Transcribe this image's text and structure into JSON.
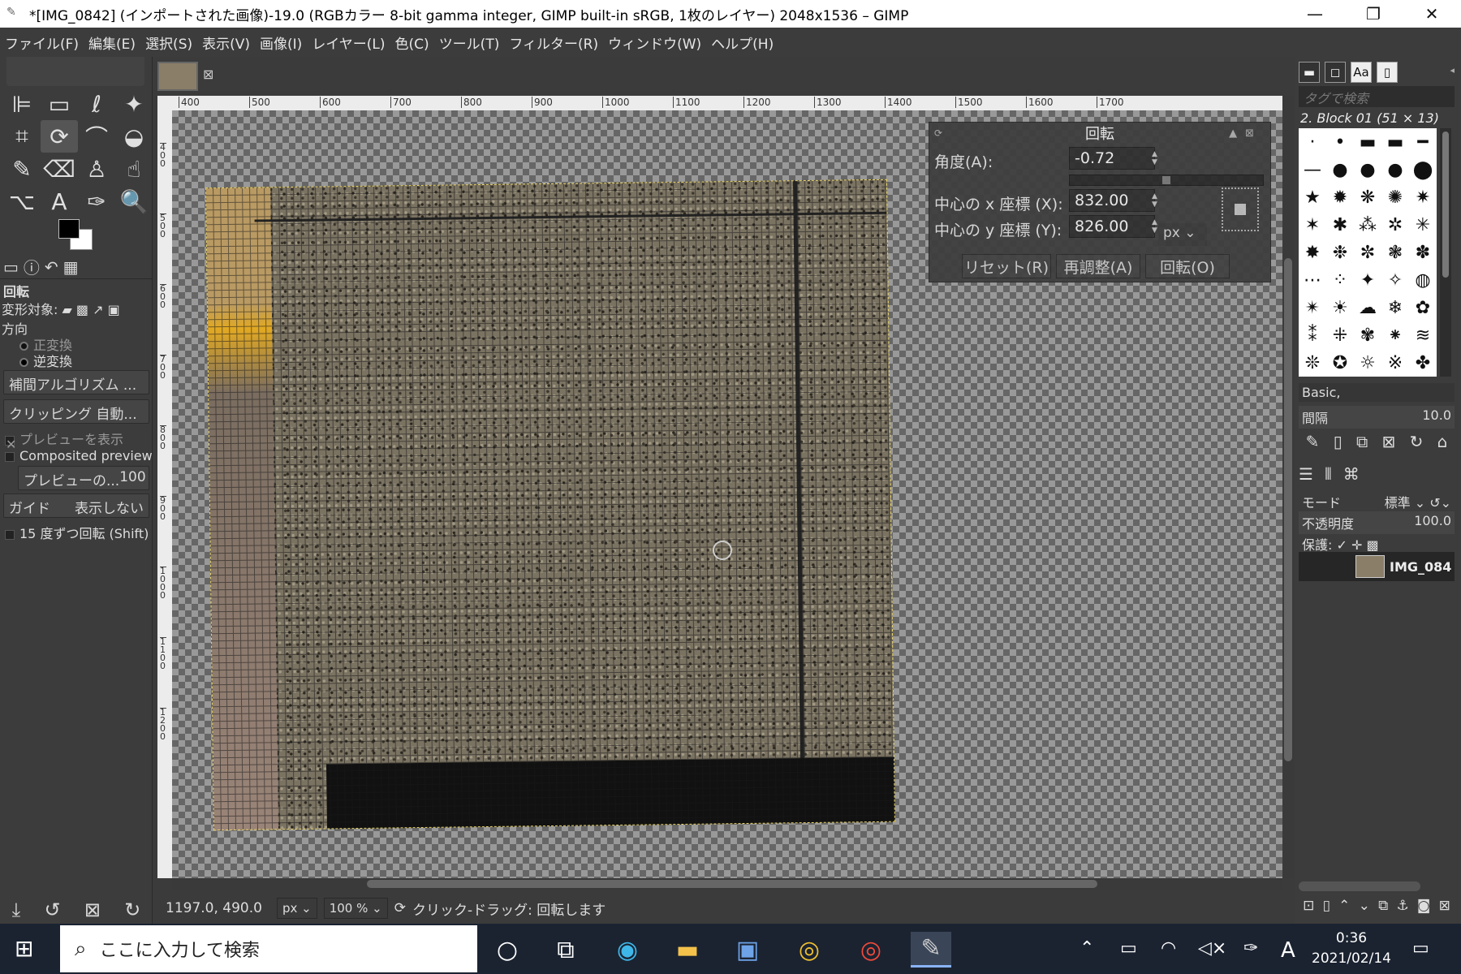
{
  "window": {
    "title": "*[IMG_0842] (インポートされた画像)-19.0 (RGBカラー 8-bit gamma integer, GIMP built-in sRGB, 1枚のレイヤー) 2048x1536 – GIMP",
    "minimize": "—",
    "maximize": "❐",
    "close": "✕"
  },
  "menu": [
    "ファイル(F)",
    "編集(E)",
    "選択(S)",
    "表示(V)",
    "画像(I)",
    "レイヤー(L)",
    "色(C)",
    "ツール(T)",
    "フィルター(R)",
    "ウィンドウ(W)",
    "ヘルプ(H)"
  ],
  "tools": [
    {
      "name": "align-tool-icon",
      "glyph": "⊫"
    },
    {
      "name": "rect-select-icon",
      "glyph": "▭"
    },
    {
      "name": "free-select-icon",
      "glyph": "ℓ"
    },
    {
      "name": "fuzzy-select-icon",
      "glyph": "✦"
    },
    {
      "name": "crop-tool-icon",
      "glyph": "⌗"
    },
    {
      "name": "unified-transform-icon",
      "glyph": "⟳"
    },
    {
      "name": "warp-transform-icon",
      "glyph": "⌒"
    },
    {
      "name": "bucket-fill-icon",
      "glyph": "◒"
    },
    {
      "name": "paintbrush-icon",
      "glyph": "✎"
    },
    {
      "name": "eraser-icon",
      "glyph": "⌫"
    },
    {
      "name": "clone-tool-icon",
      "glyph": "♙"
    },
    {
      "name": "smudge-tool-icon",
      "glyph": "☝"
    },
    {
      "name": "paths-tool-icon",
      "glyph": "⌥"
    },
    {
      "name": "text-tool-icon",
      "glyph": "A"
    },
    {
      "name": "color-picker-icon",
      "glyph": "✑"
    },
    {
      "name": "zoom-tool-icon",
      "glyph": "🔍"
    }
  ],
  "tool_options": {
    "title": "回転",
    "transform_label": "変形対象:",
    "direction_label": "方向",
    "forward": "正変換",
    "backward": "逆変換",
    "interpolation": "補間アルゴリズム ...",
    "clipping": "クリッピング 自動...",
    "show_preview": "プレビューを表示",
    "composited_preview": "Composited preview",
    "preview_opacity": "プレビューの...",
    "preview_opacity_value": "100",
    "guides_label": "ガイド",
    "guides_value": "表示しない",
    "snap15": "15 度ずつ回転 (Shift)"
  },
  "rulers": {
    "top": [
      "400",
      "500",
      "600",
      "700",
      "800",
      "900",
      "1000",
      "1100",
      "1200",
      "1300",
      "1400",
      "1500",
      "1600",
      "1700"
    ],
    "left": [
      "400",
      "500",
      "600",
      "700",
      "800",
      "900",
      "1000",
      "1100",
      "1200"
    ]
  },
  "rotate_dialog": {
    "title": "回転",
    "angle_label": "角度(A):",
    "angle_value": "-0.72",
    "cx_label": "中心の x 座標 (X):",
    "cx_value": "832.00",
    "cy_label": "中心の y 座標 (Y):",
    "cy_value": "826.00",
    "unit": "px",
    "reset": "リセット(R)",
    "readjust": "再調整(A)",
    "rotate": "回転(O)"
  },
  "dock": {
    "tag_search": "タグで検索",
    "brush_name": "2. Block 01 (51 × 13)",
    "preset": "Basic,",
    "spacing_label": "間隔",
    "spacing_value": "10.0",
    "mode_label": "モード",
    "mode_value": "標準",
    "opacity_label": "不透明度",
    "opacity_value": "100.0",
    "lock_label": "保護:",
    "layer_name": "IMG_084"
  },
  "status": {
    "coords": "1197.0, 490.0",
    "unit": "px",
    "zoom": "100 %",
    "message": "クリック-ドラッグ: 回転します"
  },
  "taskbar": {
    "search_placeholder": "ここに入力して検索",
    "time": "0:36",
    "date": "2021/02/14",
    "ime": "A"
  }
}
